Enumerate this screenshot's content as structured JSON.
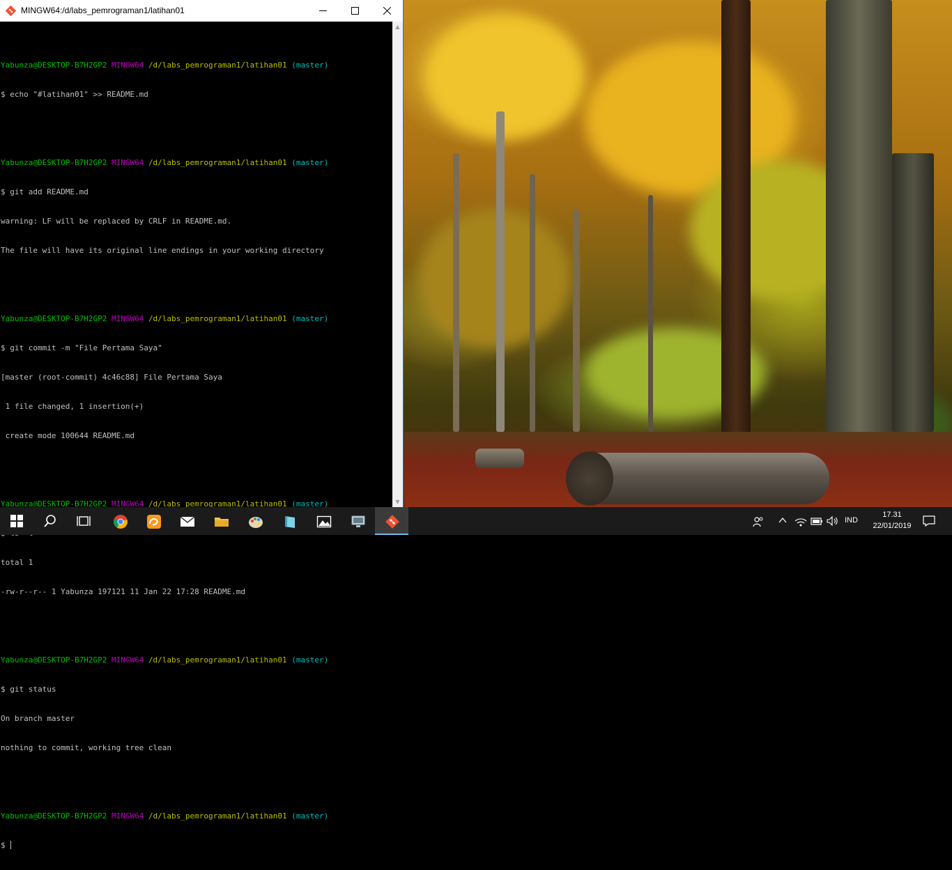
{
  "window": {
    "title": "MINGW64:/d/labs_pemrograman1/latihan01",
    "icon": "git-bash-icon"
  },
  "terminal": {
    "prompt": {
      "user": "Yabunza@DESKTOP-B7H2GP2",
      "system": "MINGW64",
      "path": "/d/labs_pemrograman1/latihan01",
      "branch": "(master)"
    },
    "blocks": [
      {
        "command": "$ echo \"#latihan01\" >> README.md",
        "output": []
      },
      {
        "command": "$ git add README.md",
        "output": [
          "warning: LF will be replaced by CRLF in README.md.",
          "The file will have its original line endings in your working directory"
        ]
      },
      {
        "command": "$ git commit -m \"File Pertama Saya\"",
        "output": [
          "[master (root-commit) 4c46c88] File Pertama Saya",
          " 1 file changed, 1 insertion(+)",
          " create mode 100644 README.md"
        ]
      },
      {
        "command": "$ ls -l",
        "output": [
          "total 1",
          "-rw-r--r-- 1 Yabunza 197121 11 Jan 22 17:28 README.md"
        ]
      },
      {
        "command": "$ git status",
        "output": [
          "On branch master",
          "nothing to commit, working tree clean"
        ]
      }
    ],
    "current_input": "$ "
  },
  "taskbar": {
    "apps": [
      {
        "name": "start-button",
        "icon": "windows-logo-icon"
      },
      {
        "name": "search-button",
        "icon": "search-icon"
      },
      {
        "name": "task-view-button",
        "icon": "task-view-icon"
      },
      {
        "name": "chrome-button",
        "icon": "chrome-icon"
      },
      {
        "name": "uc-browser-button",
        "icon": "uc-browser-icon"
      },
      {
        "name": "mail-button",
        "icon": "mail-icon"
      },
      {
        "name": "file-explorer-button",
        "icon": "folder-icon"
      },
      {
        "name": "paint-button",
        "icon": "paint-palette-icon"
      },
      {
        "name": "app-button",
        "icon": "book-icon"
      },
      {
        "name": "photos-button",
        "icon": "photos-icon"
      },
      {
        "name": "display-app-button",
        "icon": "monitor-icon"
      },
      {
        "name": "git-bash-taskbar-button",
        "icon": "git-bash-icon",
        "active": true
      }
    ],
    "tray": {
      "language": "IND",
      "time": "17.31",
      "date": "22/01/2019"
    }
  }
}
